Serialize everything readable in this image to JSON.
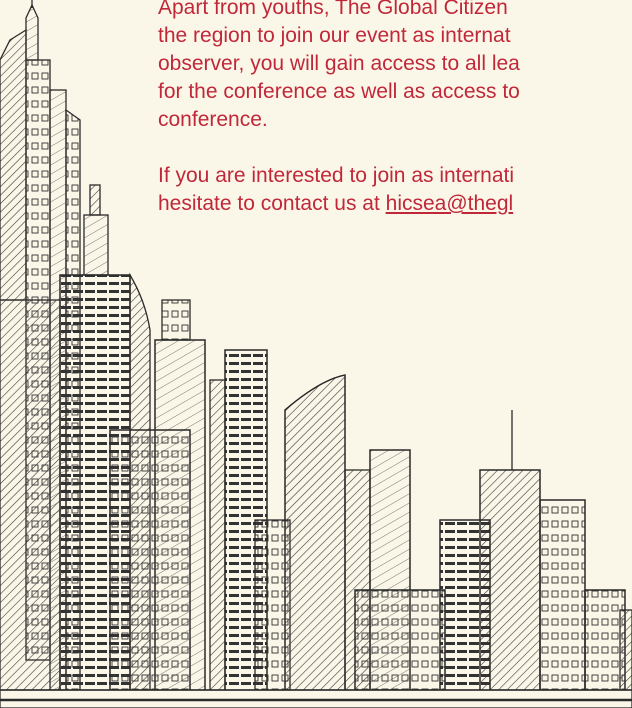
{
  "colors": {
    "background": "#fbf7e8",
    "text": "#c0283a",
    "ink": "#2b2b2b"
  },
  "content": {
    "paragraph1_lines": [
      "Apart from youths, The Global Citizen",
      "the region to join our event as internat",
      "observer, you will gain access to all lea",
      "for the conference as well as access to",
      "conference."
    ],
    "paragraph2_lines": [
      "If you are interested to join as internati",
      "hesitate to contact us at "
    ],
    "email_link_text": "hicsea@thegl"
  },
  "illustration": {
    "icon": "city-skyline-sketch-icon"
  }
}
